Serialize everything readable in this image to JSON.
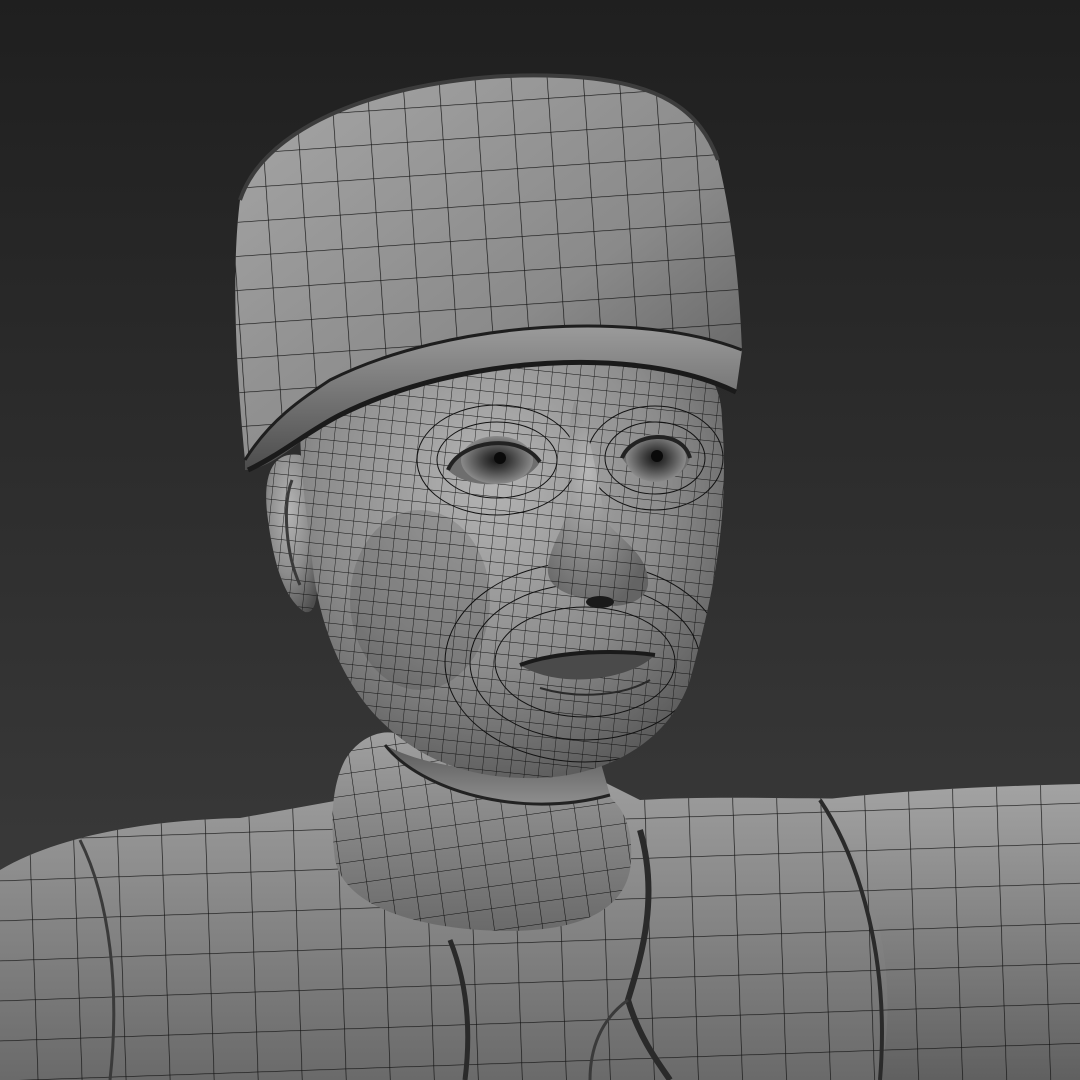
{
  "scene": {
    "subject": "wireframe-character-bust",
    "background_top": "#1f1f1f",
    "background_bottom": "#3f3f3f",
    "surface_light": "#a9a9a9",
    "surface_mid": "#7e7e7e",
    "surface_dark": "#505050",
    "wire_color": "#121212"
  }
}
